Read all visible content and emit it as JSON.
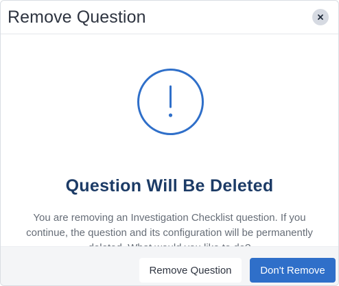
{
  "dialog": {
    "title": "Remove Question",
    "close_icon": "close-icon",
    "alert_icon": "exclamation-circle-icon",
    "heading": "Question Will Be Deleted",
    "message": "You are removing an Investigation Checklist question. If you continue, the question and its configuration will be permanently deleted. What would you like to do?"
  },
  "footer": {
    "remove_label": "Remove Question",
    "keep_label": "Don't Remove"
  },
  "colors": {
    "accent": "#2f6fc9",
    "heading": "#1c3b66",
    "text": "#666d77",
    "footer_bg": "#f4f5f7"
  }
}
